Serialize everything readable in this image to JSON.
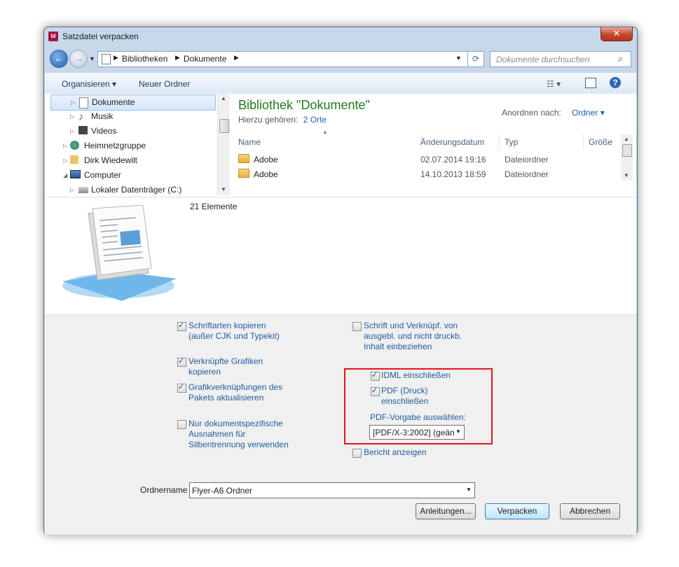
{
  "window": {
    "title": "Satzdatei verpacken",
    "app_icon": "Id"
  },
  "nav": {
    "breadcrumb": [
      "Bibliotheken",
      "Dokumente"
    ],
    "search_placeholder": "Dokumente durchsuchen"
  },
  "toolbar": {
    "organize": "Organisieren",
    "new_folder": "Neuer Ordner"
  },
  "tree": [
    {
      "label": "Dokumente",
      "icon": "documents-icon",
      "selected": true
    },
    {
      "label": "Musik",
      "icon": "music-icon"
    },
    {
      "label": "Videos",
      "icon": "video-icon"
    },
    {
      "label": "Heimnetzgruppe",
      "icon": "homegroup-icon"
    },
    {
      "label": "Dirk Wiedewilt",
      "icon": "user-folder-icon"
    },
    {
      "label": "Computer",
      "icon": "computer-icon"
    },
    {
      "label": "Lokaler Datenträger (C:)",
      "icon": "drive-icon"
    }
  ],
  "library": {
    "title": "Bibliothek \"Dokumente\"",
    "includes_label": "Hierzu gehören:",
    "includes_link": "2 Orte",
    "sort_label": "Anordnen nach:",
    "sort_value": "Ordner"
  },
  "columns": {
    "name": "Name",
    "date": "Änderungsdatum",
    "type": "Typ",
    "size": "Größe"
  },
  "files": [
    {
      "name": "Adobe",
      "date": "02.07.2014 19:16",
      "type": "Dateiordner"
    },
    {
      "name": "Adobe",
      "date": "14.10.2013 18:59",
      "type": "Dateiordner"
    }
  ],
  "details": {
    "count": "21 Elemente"
  },
  "options": {
    "fonts": {
      "label1": "Schriftarten kopieren",
      "label2": "(außer CJK und Typekit)",
      "checked": true
    },
    "graphics": {
      "label1": "Verknüpfte Grafiken",
      "label2": "kopieren",
      "checked": true
    },
    "update_links": {
      "label1": "Grafikverknüpfungen des",
      "label2": "Pakets aktualisieren",
      "checked": true
    },
    "hyphenation": {
      "label1": "Nur dokumentspezifische",
      "label2": "Ausnahmen für",
      "label3": "Silbentrennung verwenden",
      "checked": false
    },
    "hidden": {
      "label1": "Schrift und Verknüpf. von",
      "label2": "ausgebl. und nicht druckb.",
      "label3": "Inhalt einbeziehen",
      "checked": false
    },
    "idml": {
      "label": "IDML einschließen",
      "checked": true
    },
    "pdf": {
      "label1": "PDF (Druck)",
      "label2": "einschließen",
      "checked": true
    },
    "pdf_preset_label": "PDF-Vorgabe auswählen:",
    "pdf_preset_value": "[PDF/X-3:2002] (geän",
    "report": {
      "label": "Bericht anzeigen",
      "checked": false
    }
  },
  "folder": {
    "label": "Ordnername",
    "value": "Flyer-A6 Ordner"
  },
  "buttons": {
    "instructions": "Anleitungen...",
    "package": "Verpacken",
    "cancel": "Abbrechen"
  }
}
